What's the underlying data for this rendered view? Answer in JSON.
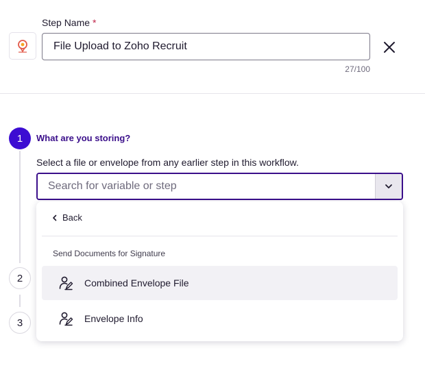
{
  "header": {
    "step_name_label": "Step Name",
    "required_mark": "*",
    "step_name_value": "File Upload to Zoho Recruit",
    "char_count": "27/100",
    "app_icon": "zoho-recruit-logo-icon",
    "close_icon": "close-icon"
  },
  "stepper": {
    "steps": [
      {
        "number": "1",
        "state": "active"
      },
      {
        "number": "2",
        "state": "inactive"
      },
      {
        "number": "3",
        "state": "inactive"
      }
    ],
    "active_color": "#3c0dd2",
    "title_color": "#3a0e8a"
  },
  "step1": {
    "title": "What are you storing?",
    "description": "Select a file or envelope from any earlier step in this workflow.",
    "search": {
      "placeholder": "Search for variable or step",
      "value": "",
      "toggle_icon": "chevron-down-icon"
    }
  },
  "dropdown": {
    "back_label": "Back",
    "back_icon": "chevron-left-icon",
    "group_label": "Send Documents for Signature",
    "options": [
      {
        "label": "Combined Envelope File",
        "icon": "user-sign-icon",
        "highlighted": true
      },
      {
        "label": "Envelope Info",
        "icon": "user-sign-icon",
        "highlighted": false
      }
    ]
  }
}
